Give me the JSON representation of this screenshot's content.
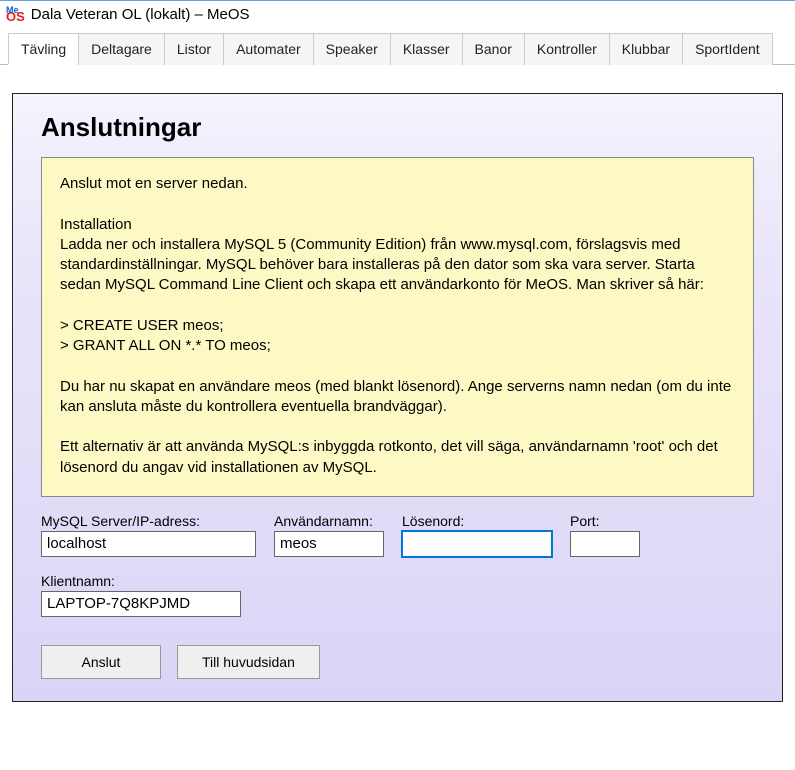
{
  "window": {
    "title": "Dala Veteran OL (lokalt) – MeOS"
  },
  "tabs": {
    "t0": "Tävling",
    "t1": "Deltagare",
    "t2": "Listor",
    "t3": "Automater",
    "t4": "Speaker",
    "t5": "Klasser",
    "t6": "Banor",
    "t7": "Kontroller",
    "t8": "Klubbar",
    "t9": "SportIdent"
  },
  "page": {
    "heading": "Anslutningar",
    "info_text": "Anslut mot en server nedan.\n\nInstallation\nLadda ner och installera MySQL 5 (Community Edition) från www.mysql.com, förslagsvis med standardinställningar. MySQL behöver bara installeras på den dator som ska vara server. Starta sedan MySQL Command Line Client och skapa ett användarkonto för MeOS. Man skriver så här:\n\n> CREATE USER meos;\n> GRANT ALL ON *.* TO meos;\n\nDu har nu skapat en användare meos (med blankt lösenord). Ange serverns namn nedan (om du inte kan ansluta måste du kontrollera eventuella brandväggar).\n\nEtt alternativ är att använda MySQL:s inbyggda rotkonto, det vill säga, användarnamn 'root' och det lösenord du angav vid installationen av MySQL."
  },
  "form": {
    "server_label": "MySQL Server/IP-adress:",
    "server_value": "localhost",
    "user_label": "Användarnamn:",
    "user_value": "meos",
    "password_label": "Lösenord:",
    "password_value": "",
    "port_label": "Port:",
    "port_value": "",
    "client_label": "Klientnamn:",
    "client_value": "LAPTOP-7Q8KPJMD"
  },
  "buttons": {
    "connect": "Anslut",
    "main_page": "Till huvudsidan"
  }
}
